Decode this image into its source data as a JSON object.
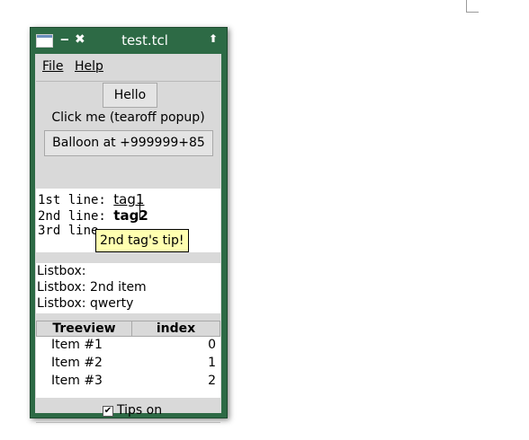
{
  "window": {
    "title": "test.tcl"
  },
  "menu": {
    "file": "File",
    "help": "Help"
  },
  "buttons": {
    "hello": "Hello",
    "balloon": "Balloon at +999999+85"
  },
  "label_tearoff": "Click me (tearoff popup)",
  "text_widget": {
    "line1_prefix": "1st line: ",
    "line1_tag": "tag1",
    "line2_prefix": "2nd line: ",
    "line2_tag": "tag2",
    "line3_prefix": "3rd line"
  },
  "tooltip": "2nd tag's tip!",
  "listbox": {
    "items": [
      "Listbox:",
      "Listbox: 2nd item",
      "Listbox: qwerty"
    ]
  },
  "treeview": {
    "headers": [
      "Treeview",
      "index"
    ],
    "rows": [
      {
        "name": "Item #1",
        "index": "0"
      },
      {
        "name": "Item #2",
        "index": "1"
      },
      {
        "name": "Item #3",
        "index": "2"
      }
    ]
  },
  "tips_checkbox": {
    "label": "Tips on",
    "mark": "✔"
  },
  "icons": {
    "min": "‒",
    "close": "✖",
    "up": "⬆"
  }
}
